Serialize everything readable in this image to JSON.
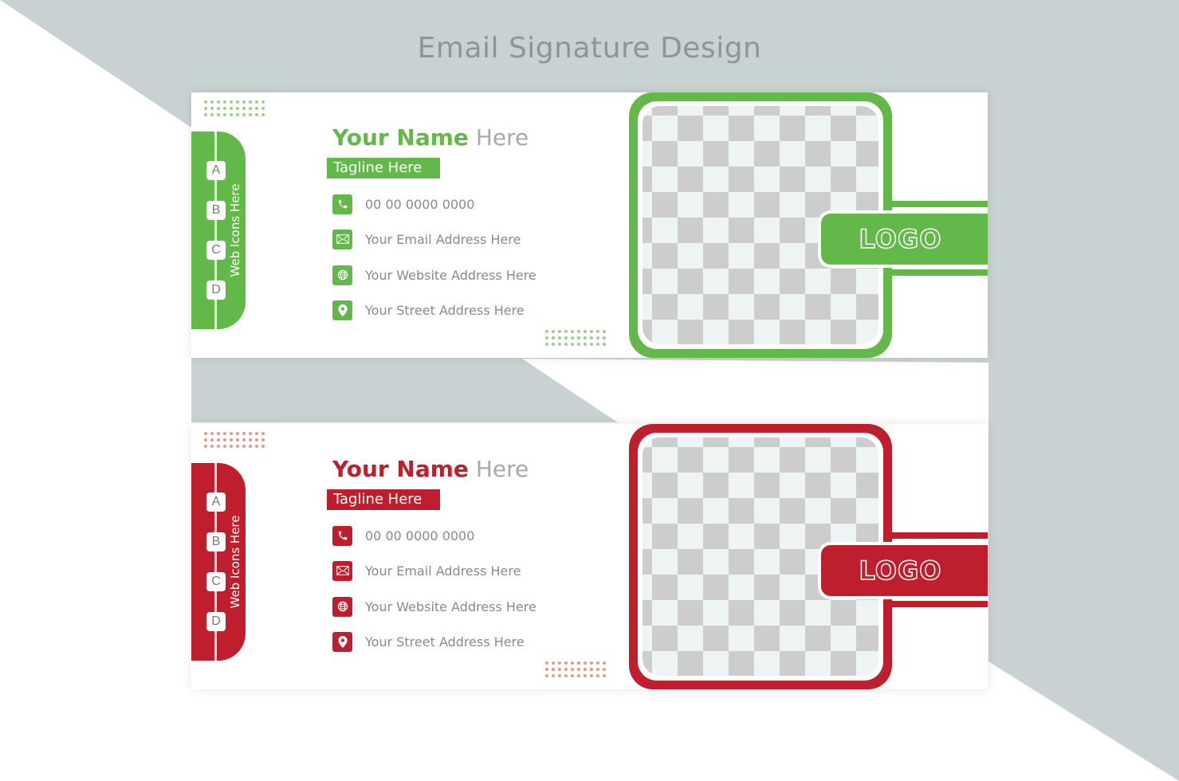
{
  "page": {
    "title": "Email Signature Design",
    "background_color": "#c9d2d2"
  },
  "cards": [
    {
      "variant": "green",
      "accent": "#62b849",
      "dots_color": "#9fcf90",
      "sidebar": {
        "letters": [
          "A",
          "B",
          "C",
          "D"
        ],
        "label": "Web Icons Here"
      },
      "name": {
        "first": "Your Name",
        "second": "Here"
      },
      "tagline": "Tagline Here",
      "contacts": [
        {
          "icon": "phone-icon",
          "text": "00 00 0000 0000"
        },
        {
          "icon": "email-icon",
          "text": "Your Email Address Here"
        },
        {
          "icon": "globe-icon",
          "text": "Your Website Address Here"
        },
        {
          "icon": "location-pin-icon",
          "text": "Your Street Address Here"
        }
      ],
      "photo_placeholder": "transparent-checkerboard",
      "logo": "LOGO"
    },
    {
      "variant": "red",
      "accent": "#bf1f2c",
      "dots_color": "#d8a08e",
      "sidebar": {
        "letters": [
          "A",
          "B",
          "C",
          "D"
        ],
        "label": "Web Icons Here"
      },
      "name": {
        "first": "Your Name",
        "second": "Here"
      },
      "tagline": "Tagline Here",
      "contacts": [
        {
          "icon": "phone-icon",
          "text": "00 00 0000 0000"
        },
        {
          "icon": "email-icon",
          "text": "Your Email Address Here"
        },
        {
          "icon": "globe-icon",
          "text": "Your Website Address Here"
        },
        {
          "icon": "location-pin-icon",
          "text": "Your Street Address Here"
        }
      ],
      "photo_placeholder": "transparent-checkerboard",
      "logo": "LOGO"
    }
  ]
}
